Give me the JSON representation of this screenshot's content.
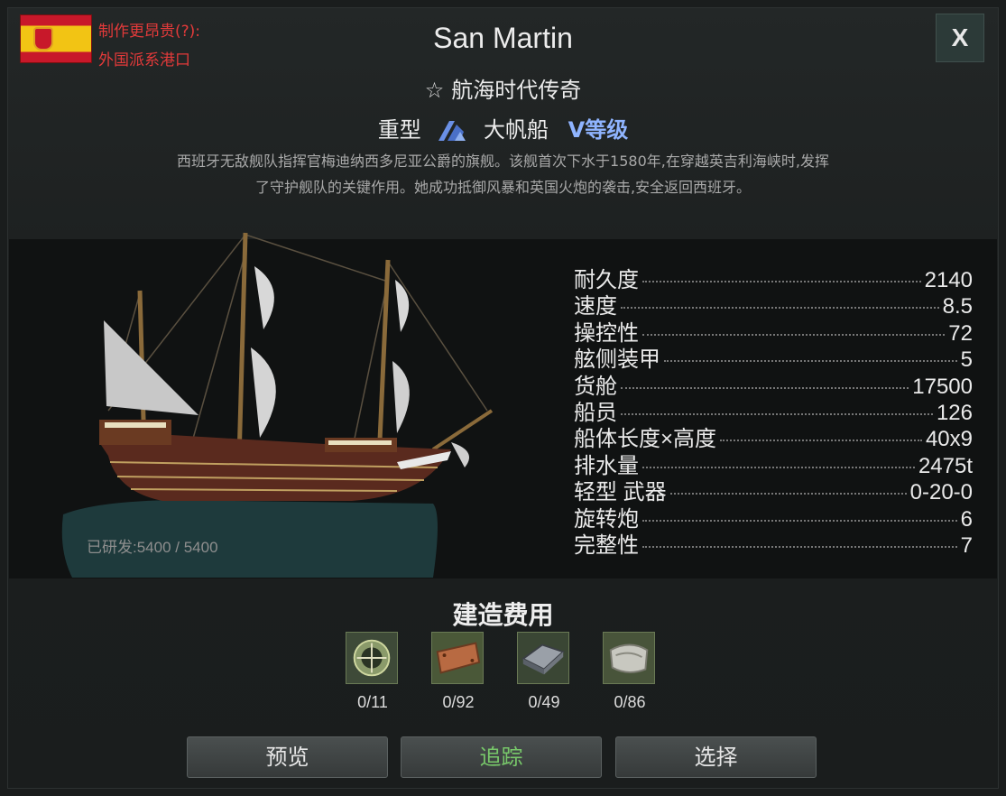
{
  "faction": {
    "note_top": "制作更昂贵(?):",
    "note_bottom": "外国派系港口"
  },
  "ship": {
    "name": "San Martin",
    "legend": "航海时代传奇",
    "weight_class": "重型",
    "ship_class": "大帆船",
    "tier": "V等级",
    "description_line1": "西班牙无敌舰队指挥官梅迪纳西多尼亚公爵的旗舰。该舰首次下水于1580年,在穿越英吉利海峡时,发挥",
    "description_line2": "了守护舰队的关键作用。她成功抵御风暴和英国火炮的袭击,安全返回西班牙。",
    "research_progress": "已研发:5400  /  5400"
  },
  "close_label": "X",
  "stats": [
    {
      "label": "耐久度",
      "value": "2140"
    },
    {
      "label": "速度",
      "value": "8.5"
    },
    {
      "label": "操控性",
      "value": "72"
    },
    {
      "label": "舷侧装甲",
      "value": "5"
    },
    {
      "label": "货舱",
      "value": "17500"
    },
    {
      "label": "船员",
      "value": "126"
    },
    {
      "label": "船体长度×高度",
      "value": "40x9"
    },
    {
      "label": "排水量",
      "value": "2475t"
    },
    {
      "label": "轻型 武器",
      "value": "0-20-0"
    },
    {
      "label": "旋转炮",
      "value": "6"
    },
    {
      "label": "完整性",
      "value": "7"
    }
  ],
  "cost": {
    "title": "建造费用",
    "items": [
      {
        "icon": "compass-icon",
        "count": "0/11"
      },
      {
        "icon": "copper-plate-icon",
        "count": "0/92"
      },
      {
        "icon": "iron-ingot-icon",
        "count": "0/49"
      },
      {
        "icon": "canvas-cloth-icon",
        "count": "0/86"
      }
    ]
  },
  "buttons": {
    "preview": "预览",
    "track": "追踪",
    "select": "选择"
  },
  "colors": {
    "faction_text": "#e33a3a",
    "tier_accent": "#8fb4ff",
    "track_accent": "#78c86a"
  }
}
